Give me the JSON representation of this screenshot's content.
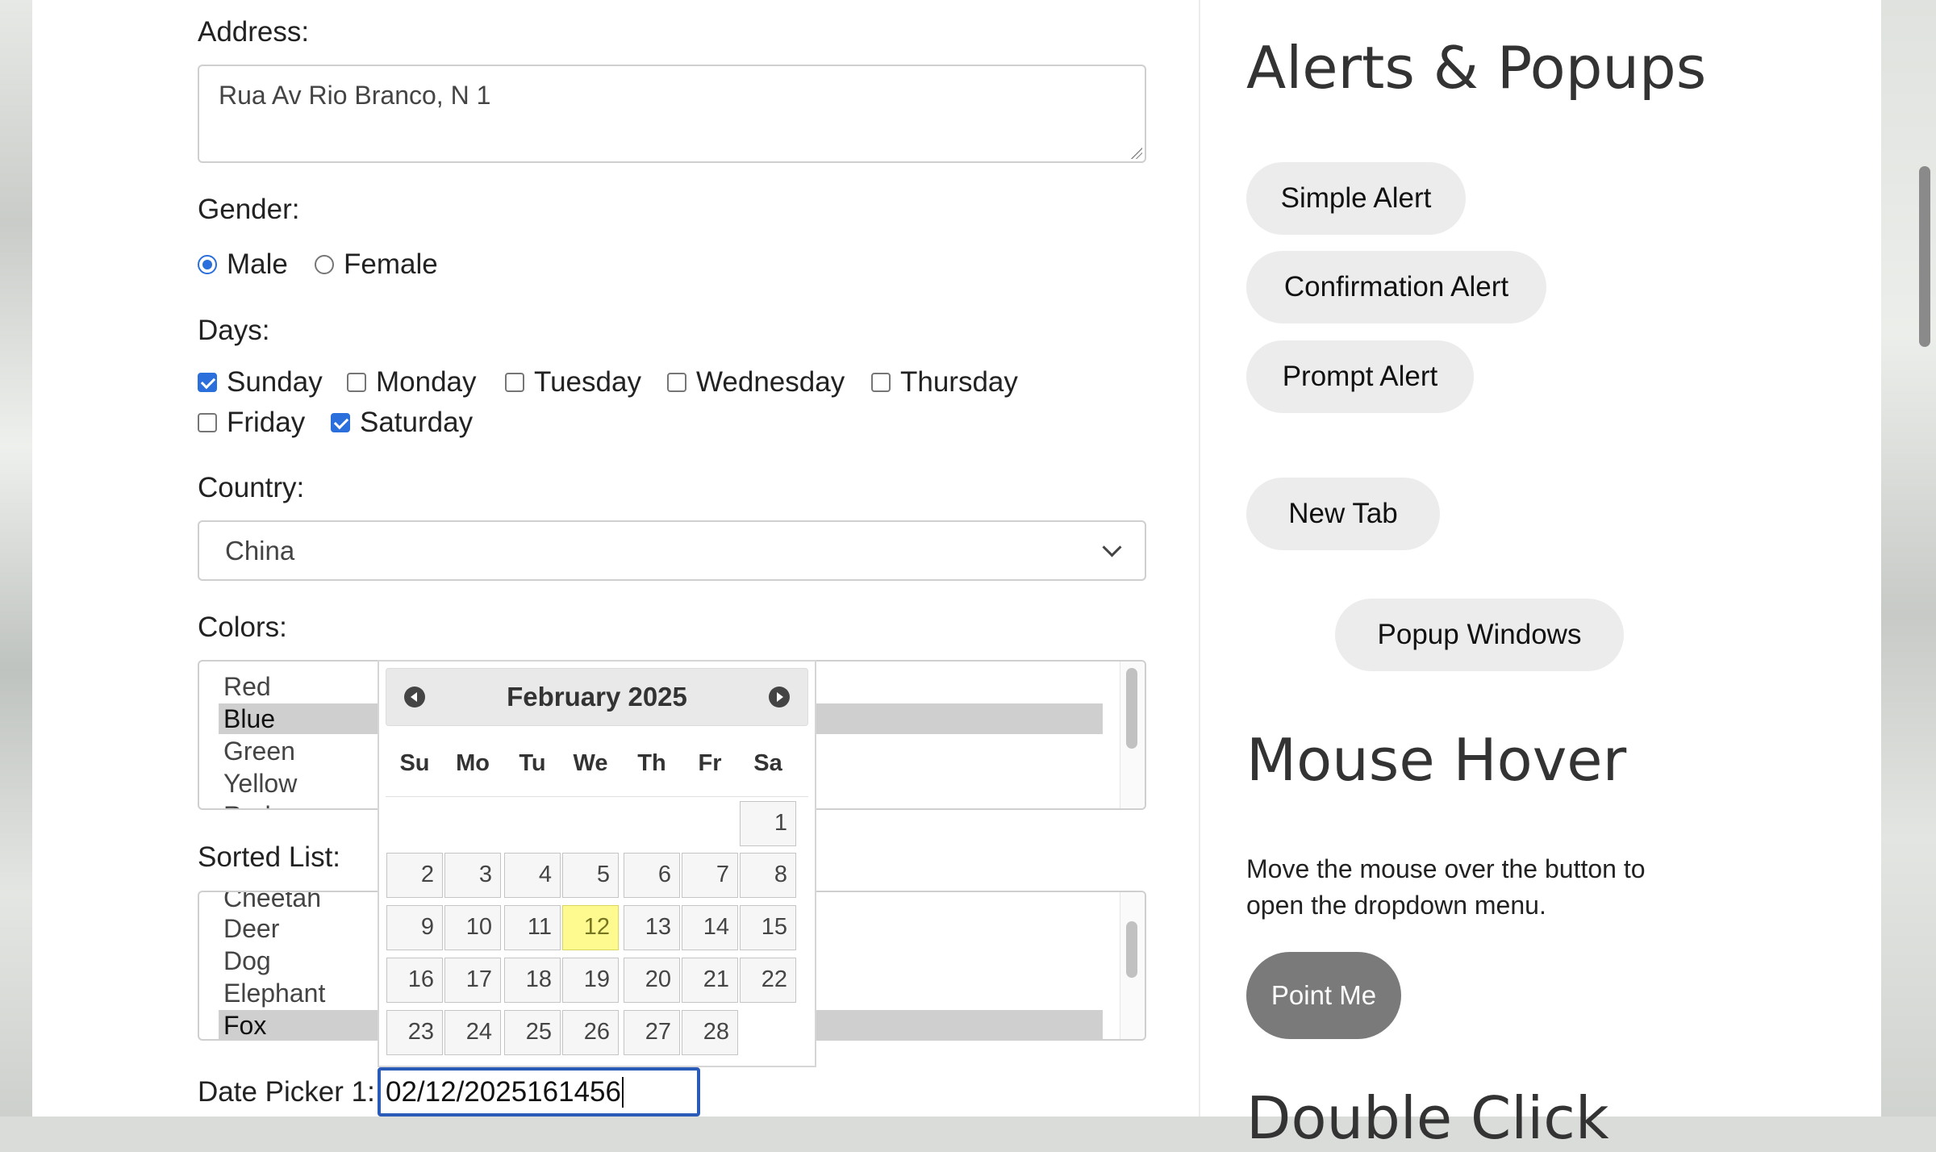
{
  "form": {
    "address_label": "Address:",
    "address_value": "Rua Av Rio Branco, N 1",
    "gender_label": "Gender:",
    "gender_options": [
      "Male",
      "Female"
    ],
    "gender_selected": "Male",
    "days_label": "Days:",
    "days": [
      {
        "label": "Sunday",
        "checked": true
      },
      {
        "label": "Monday",
        "checked": false
      },
      {
        "label": "Tuesday",
        "checked": false
      },
      {
        "label": "Wednesday",
        "checked": false
      },
      {
        "label": "Thursday",
        "checked": false
      },
      {
        "label": "Friday",
        "checked": false
      },
      {
        "label": "Saturday",
        "checked": true
      }
    ],
    "country_label": "Country:",
    "country_value": "China",
    "colors_label": "Colors:",
    "colors_items": [
      "Red",
      "Blue",
      "Green",
      "Yellow",
      "Red"
    ],
    "colors_selected": "Blue",
    "sorted_label": "Sorted List:",
    "sorted_items": [
      "Cheetah",
      "Deer",
      "Dog",
      "Elephant",
      "Fox"
    ],
    "sorted_selected": "Fox",
    "datepicker_label": "Date Picker 1:",
    "datepicker_value": "02/12/2025161456"
  },
  "calendar": {
    "month_title": "February 2025",
    "weekdays": [
      "Su",
      "Mo",
      "Tu",
      "We",
      "Th",
      "Fr",
      "Sa"
    ],
    "weeks": [
      [
        "",
        "",
        "",
        "",
        "",
        "",
        "1"
      ],
      [
        "2",
        "3",
        "4",
        "5",
        "6",
        "7",
        "8"
      ],
      [
        "9",
        "10",
        "11",
        "12",
        "13",
        "14",
        "15"
      ],
      [
        "16",
        "17",
        "18",
        "19",
        "20",
        "21",
        "22"
      ],
      [
        "23",
        "24",
        "25",
        "26",
        "27",
        "28",
        ""
      ]
    ],
    "highlighted_day": "12"
  },
  "sidebar": {
    "alerts_heading": "Alerts & Popups",
    "simple_alert": "Simple Alert",
    "confirmation_alert": "Confirmation Alert",
    "prompt_alert": "Prompt Alert",
    "new_tab": "New Tab",
    "popup_windows": "Popup Windows",
    "mouse_hover_heading": "Mouse Hover",
    "mouse_hover_text": "Move the mouse over the button to open the dropdown menu.",
    "point_me": "Point Me",
    "double_click_heading": "Double Click"
  },
  "colors": {
    "accent": "#2a6fdb",
    "focus_border": "#2b5bb8",
    "today_bg": "#fffa90",
    "pill_bg": "#ececec",
    "point_me_bg": "#7a7a7a"
  }
}
